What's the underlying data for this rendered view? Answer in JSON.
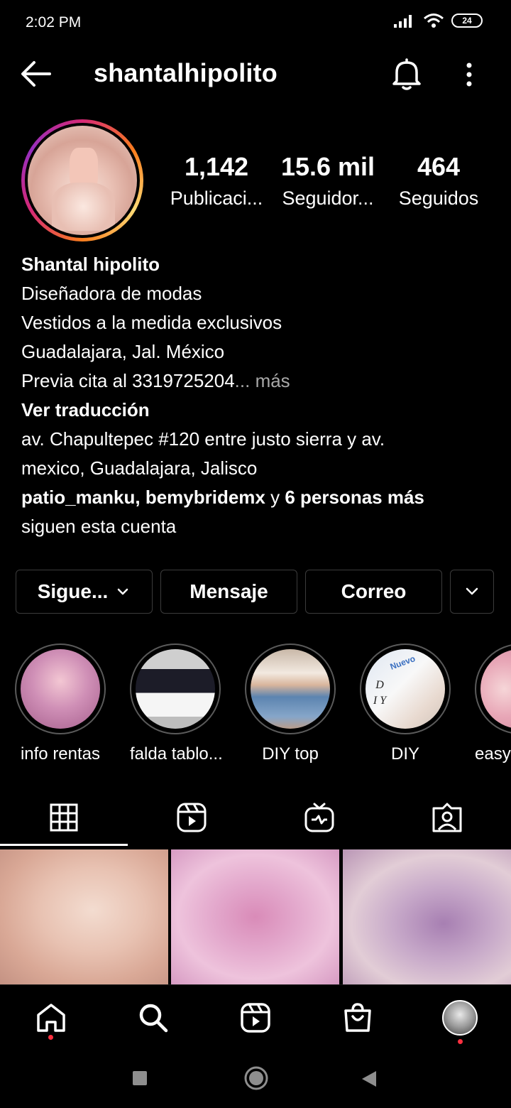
{
  "status_bar": {
    "time": "2:02 PM",
    "battery": "24"
  },
  "header": {
    "username": "shantalhipolito"
  },
  "stats": [
    {
      "value": "1,142",
      "label": "Publicaci..."
    },
    {
      "value": "15.6 mil",
      "label": "Seguidor..."
    },
    {
      "value": "464",
      "label": "Seguidos"
    }
  ],
  "bio": {
    "name": "Shantal hipolito",
    "lines": [
      "Diseñadora de modas",
      "Vestidos a la medida exclusivos",
      "Guadalajara, Jal. México"
    ],
    "line4": "Previa cita al 3319725204",
    "more": "... más",
    "translate": "Ver traducción",
    "address_1": "av. Chapultepec #120  entre justo sierra y av.",
    "address_2": "mexico, Guadalajara, Jalisco",
    "followed_by_users": "patio_manku, bemybridemx",
    "followed_by_and": " y ",
    "followed_by_others": "6 personas más",
    "followed_by_suffix": "siguen esta cuenta"
  },
  "actions": {
    "follow": "Sigue...",
    "message": "Mensaje",
    "email": "Correo"
  },
  "highlights": [
    {
      "label": "info rentas"
    },
    {
      "label": "falda tablo..."
    },
    {
      "label": "DIY top"
    },
    {
      "label": "DIY"
    },
    {
      "label": "easy"
    }
  ],
  "highlight_overlay_text": {
    "nuevo": "Nuevo",
    "diy": "D I Y"
  },
  "tabs": [
    "grid-icon",
    "reels-icon",
    "igtv-icon",
    "tagged-icon"
  ],
  "bottom_nav": [
    "home-icon",
    "search-icon",
    "reels-icon",
    "shop-icon",
    "profile-avatar"
  ],
  "colors": {
    "background": "#000000",
    "text": "#ffffff",
    "muted": "#a8a8a8",
    "border": "#3c3c3c",
    "notification": "#ff3040"
  }
}
